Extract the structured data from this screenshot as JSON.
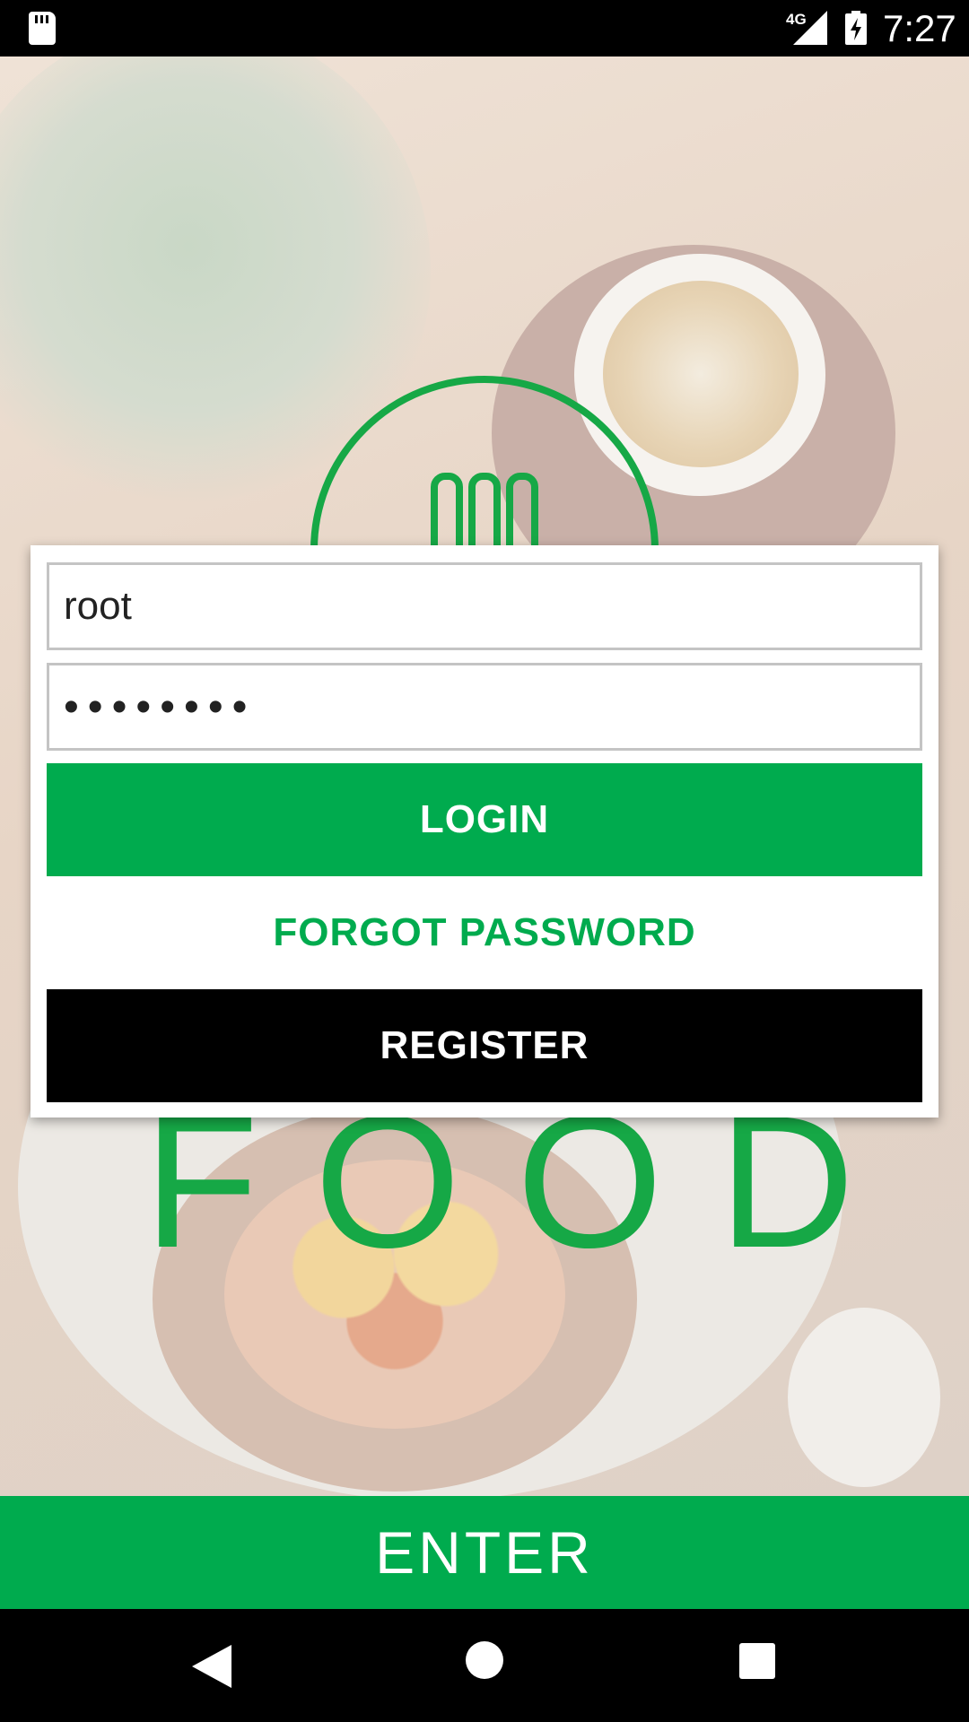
{
  "status_bar": {
    "network_type": "4G",
    "time": "7:27",
    "icons": [
      "sd-card-icon",
      "signal-icon",
      "battery-charging-icon"
    ]
  },
  "background": {
    "logo_text": "FOOD",
    "logo_icon": "fork-icon"
  },
  "login_dialog": {
    "username_value": "root",
    "password_value": "••••••••",
    "login_label": "LOGIN",
    "forgot_label": "FORGOT PASSWORD",
    "register_label": "REGISTER"
  },
  "enter_label": "ENTER",
  "nav_bar": {
    "icons": [
      "back-icon",
      "home-icon",
      "recents-icon"
    ]
  },
  "colors": {
    "accent": "#00ab4e",
    "register_bg": "#000000",
    "dialog_bg": "#ffffff"
  }
}
